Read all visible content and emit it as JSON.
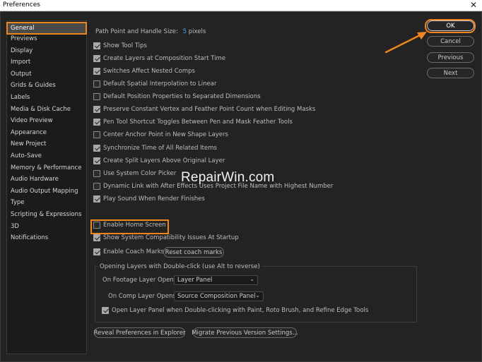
{
  "window": {
    "title": "Preferences",
    "close_glyph": "✕"
  },
  "sidebar": {
    "items": [
      {
        "label": "General",
        "selected": true
      },
      {
        "label": "Previews"
      },
      {
        "label": "Display"
      },
      {
        "label": "Import"
      },
      {
        "label": "Output"
      },
      {
        "label": "Grids & Guides"
      },
      {
        "label": "Labels"
      },
      {
        "label": "Media & Disk Cache"
      },
      {
        "label": "Video Preview"
      },
      {
        "label": "Appearance"
      },
      {
        "label": "New Project"
      },
      {
        "label": "Auto-Save"
      },
      {
        "label": "Memory & Performance"
      },
      {
        "label": "Audio Hardware"
      },
      {
        "label": "Audio Output Mapping"
      },
      {
        "label": "Type"
      },
      {
        "label": "Scripting & Expressions"
      },
      {
        "label": "3D"
      },
      {
        "label": "Notifications"
      }
    ]
  },
  "general": {
    "path_point_label": "Path Point and Handle Size:",
    "path_point_value": "5",
    "path_point_unit": "pixels",
    "options": [
      {
        "label": "Show Tool Tips",
        "checked": true
      },
      {
        "label": "Create Layers at Composition Start Time",
        "checked": true
      },
      {
        "label": "Switches Affect Nested Comps",
        "checked": true
      },
      {
        "label": "Default Spatial Interpolation to Linear",
        "checked": false
      },
      {
        "label": "Default Position Properties to Separated Dimensions",
        "checked": false
      },
      {
        "label": "Preserve Constant Vertex and Feather Point Count when Editing Masks",
        "checked": true
      },
      {
        "label": "Pen Tool Shortcut Toggles Between Pen and Mask Feather Tools",
        "checked": true
      },
      {
        "label": "Center Anchor Point in New Shape Layers",
        "checked": false
      },
      {
        "label": "Synchronize Time of All Related Items",
        "checked": true
      },
      {
        "label": "Create Split Layers Above Original Layer",
        "checked": true
      },
      {
        "label": "Use System Color Picker",
        "checked": false
      },
      {
        "label": "Dynamic Link with After Effects Uses Project File Name with Highest Number",
        "checked": false
      },
      {
        "label": "Play Sound When Render Finishes",
        "checked": true
      }
    ],
    "home_screen": {
      "label": "Enable Home Screen",
      "checked": false
    },
    "compat": {
      "label": "Show System Compatibility Issues At Startup",
      "checked": true
    },
    "coach": {
      "label": "Enable Coach Marks",
      "checked": true
    },
    "reset_coach_label": "Reset coach marks",
    "group": {
      "title": "Opening Layers with Double-click (use Alt to reverse)",
      "footage_label": "On Footage Layer Opens:",
      "footage_value": "Layer Panel",
      "comp_label": "On Comp Layer Opens:",
      "comp_value": "Source Composition Panel",
      "open_layer": {
        "label": "Open Layer Panel when Double-clicking with Paint, Roto Brush, and Refine Edge Tools",
        "checked": true
      }
    },
    "reveal_label": "Reveal Preferences in Explorer",
    "migrate_label": "Migrate Previous Version Settings..."
  },
  "buttons": {
    "ok": "OK",
    "cancel": "Cancel",
    "previous": "Previous",
    "next": "Next"
  },
  "watermark": "RepairWin.com",
  "colors": {
    "highlight": "#f0841f",
    "accent": "#4da3ff"
  }
}
